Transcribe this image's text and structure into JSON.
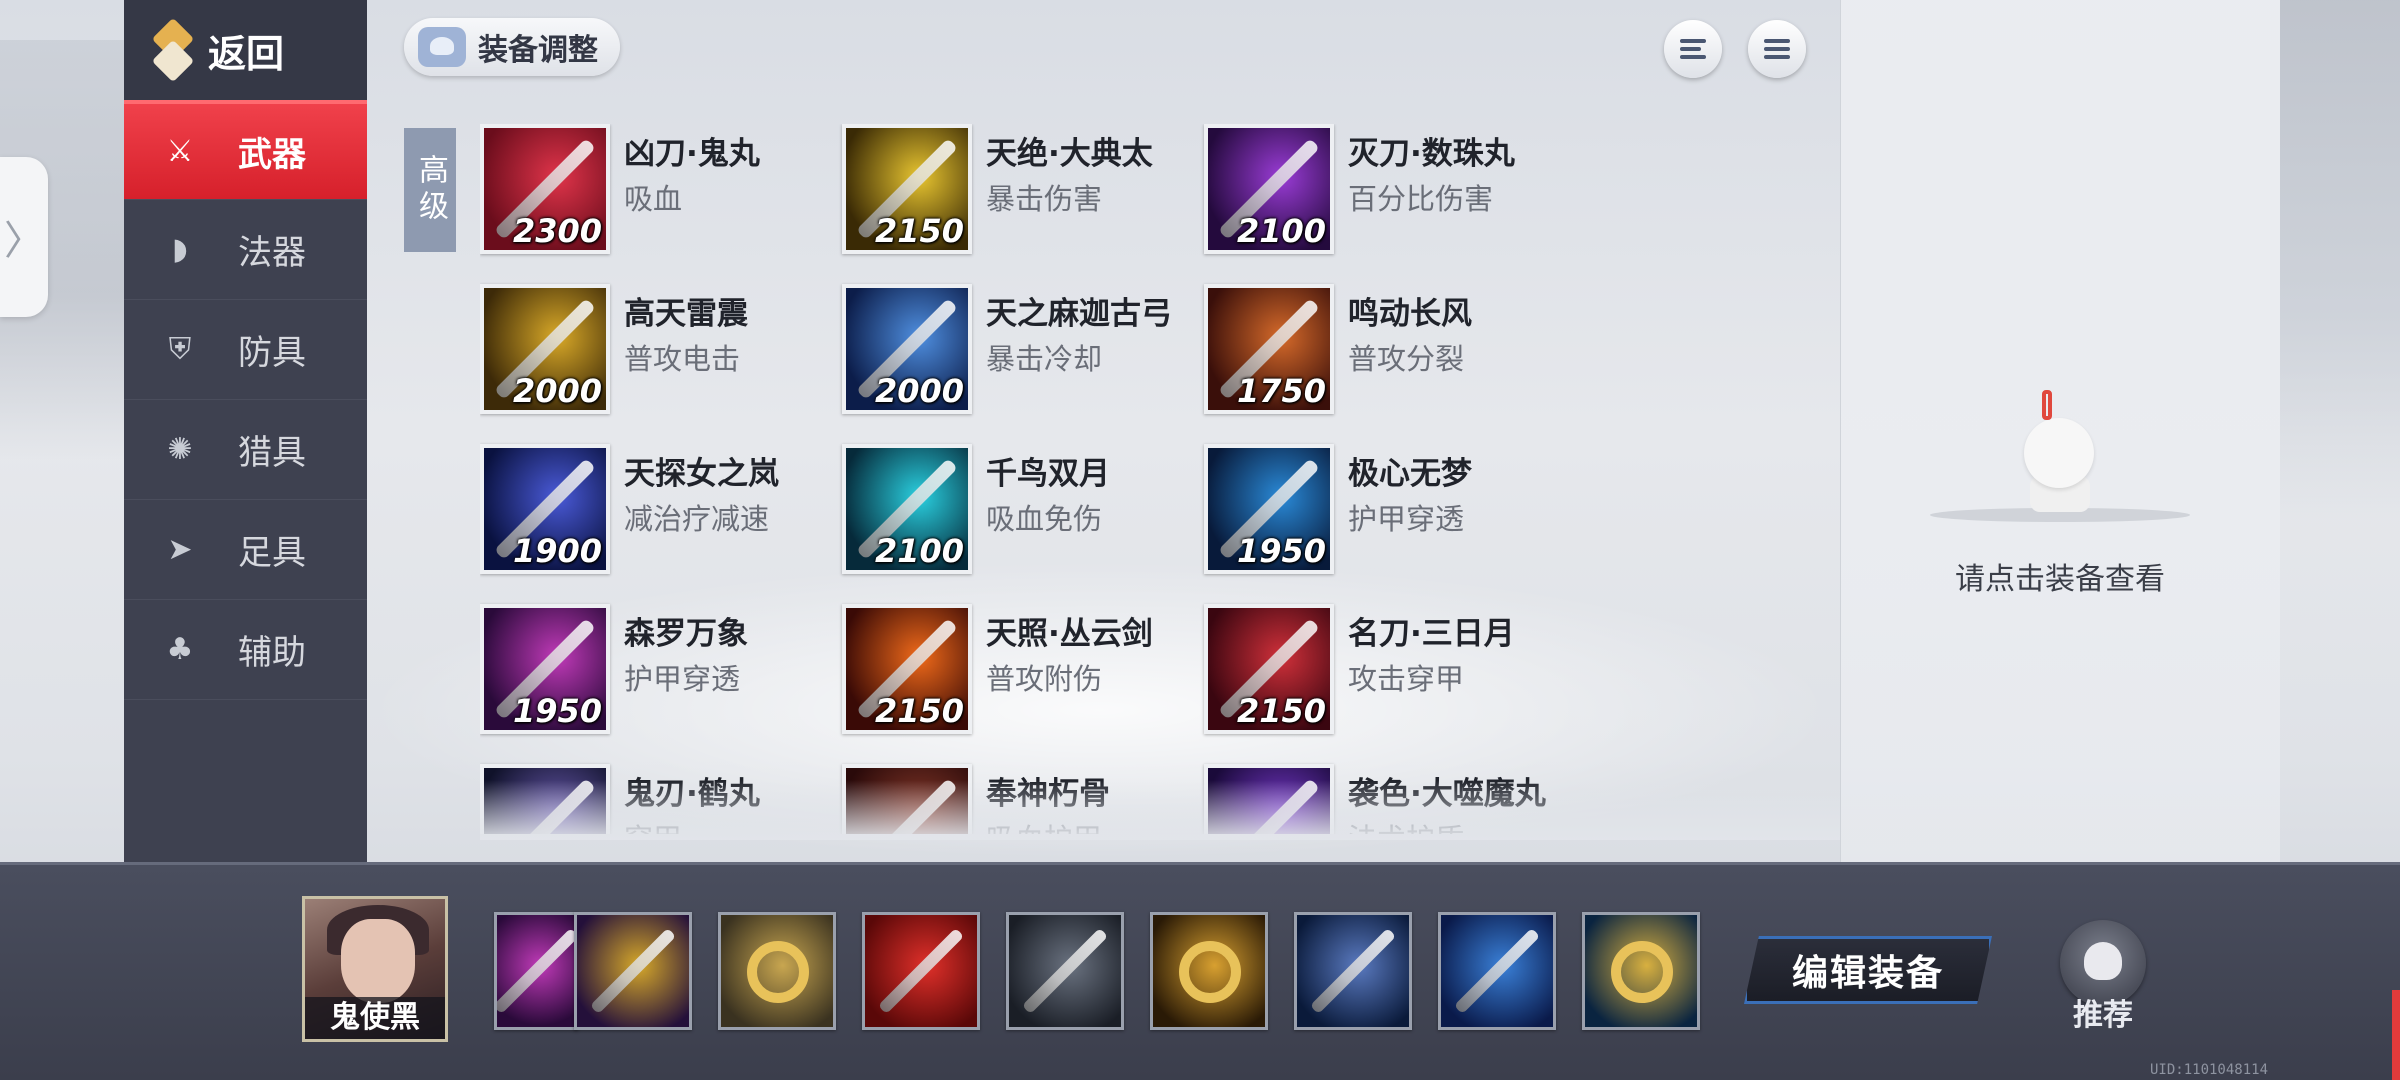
{
  "sidebar": {
    "back_label": "返回",
    "items": [
      {
        "label": "武器",
        "icon": "sword-icon",
        "active": true
      },
      {
        "label": "法器",
        "icon": "fan-icon",
        "active": false
      },
      {
        "label": "防具",
        "icon": "shield-icon",
        "active": false
      },
      {
        "label": "猎具",
        "icon": "octopus-icon",
        "active": false
      },
      {
        "label": "足具",
        "icon": "boot-icon",
        "active": false
      },
      {
        "label": "辅助",
        "icon": "clover-icon",
        "active": false
      }
    ]
  },
  "header": {
    "adjust_label": "装备调整",
    "tier_label": "高级"
  },
  "equipment": [
    {
      "name": "凶刀·鬼丸",
      "desc": "吸血",
      "price": "2300",
      "color_a": "#6b0d1c",
      "color_b": "#e0344a"
    },
    {
      "name": "天绝·大典太",
      "desc": "暴击伤害",
      "price": "2150",
      "color_a": "#3a2a05",
      "color_b": "#e8c530"
    },
    {
      "name": "灭刀·数珠丸",
      "desc": "百分比伤害",
      "price": "2100",
      "color_a": "#240a3d",
      "color_b": "#9a3cd6"
    },
    {
      "name": "高天雷震",
      "desc": "普攻电击",
      "price": "2000",
      "color_a": "#3d2a08",
      "color_b": "#d9a928"
    },
    {
      "name": "天之麻迦古弓",
      "desc": "暴击冷却",
      "price": "2000",
      "color_a": "#0c1d4a",
      "color_b": "#4f8fe0"
    },
    {
      "name": "鸣动长风",
      "desc": "普攻分裂",
      "price": "1750",
      "color_a": "#3a0f0a",
      "color_b": "#d66a2a"
    },
    {
      "name": "天探女之岚",
      "desc": "减治疗减速",
      "price": "1900",
      "color_a": "#0a1240",
      "color_b": "#4a5ad8"
    },
    {
      "name": "千鸟双月",
      "desc": "吸血免伤",
      "price": "2100",
      "color_a": "#062a3a",
      "color_b": "#2ad0e0"
    },
    {
      "name": "极心无梦",
      "desc": "护甲穿透",
      "price": "1950",
      "color_a": "#081a3a",
      "color_b": "#2a8ad8"
    },
    {
      "name": "森罗万象",
      "desc": "护甲穿透",
      "price": "1950",
      "color_a": "#2a0a3a",
      "color_b": "#c03ab8"
    },
    {
      "name": "天照·丛云剑",
      "desc": "普攻附伤",
      "price": "2150",
      "color_a": "#3a0a06",
      "color_b": "#f06a1a"
    },
    {
      "name": "名刀·三日月",
      "desc": "攻击穿甲",
      "price": "2150",
      "color_a": "#3a0610",
      "color_b": "#d0303a"
    },
    {
      "name": "鬼刃·鹤丸",
      "desc": "穿甲",
      "price": "",
      "color_a": "#10122a",
      "color_b": "#6a5ab0"
    },
    {
      "name": "奉神朽骨",
      "desc": "吸血护甲",
      "price": "",
      "color_a": "#2a0a0a",
      "color_b": "#8a3a2a"
    },
    {
      "name": "袭色·大噬魔丸",
      "desc": "法术护盾",
      "price": "",
      "color_a": "#1a0a3a",
      "color_b": "#7a3ad0"
    }
  ],
  "detail": {
    "hint": "请点击装备查看"
  },
  "bottom": {
    "hero_name": "鬼使黑",
    "slots": [
      {
        "icon": "scythe-icon",
        "color_a": "#2a0a3a",
        "color_b": "#c03ab8"
      },
      {
        "icon": "katana-icon",
        "color_a": "#24103a",
        "color_b": "#d6a82a"
      },
      {
        "icon": "ring-icon",
        "color_a": "#3a3220",
        "color_b": "#c8a650"
      },
      {
        "icon": "oni-mask-icon",
        "color_a": "#5a0808",
        "color_b": "#e0302a"
      },
      {
        "icon": "dagger-icon",
        "color_a": "#1a1e26",
        "color_b": "#6a7280"
      },
      {
        "icon": "gold-ring-icon",
        "color_a": "#2a1a06",
        "color_b": "#d8a030"
      },
      {
        "icon": "armor-icon",
        "color_a": "#0a1a3a",
        "color_b": "#5a7ac0"
      },
      {
        "icon": "bow-icon",
        "color_a": "#0a1a4a",
        "color_b": "#3a80d8"
      },
      {
        "icon": "amulet-icon",
        "color_a": "#0a2440",
        "color_b": "#d8b040"
      }
    ],
    "edit_label": "编辑装备",
    "recommend_label": "推荐",
    "uid": "UID:1101048114"
  }
}
